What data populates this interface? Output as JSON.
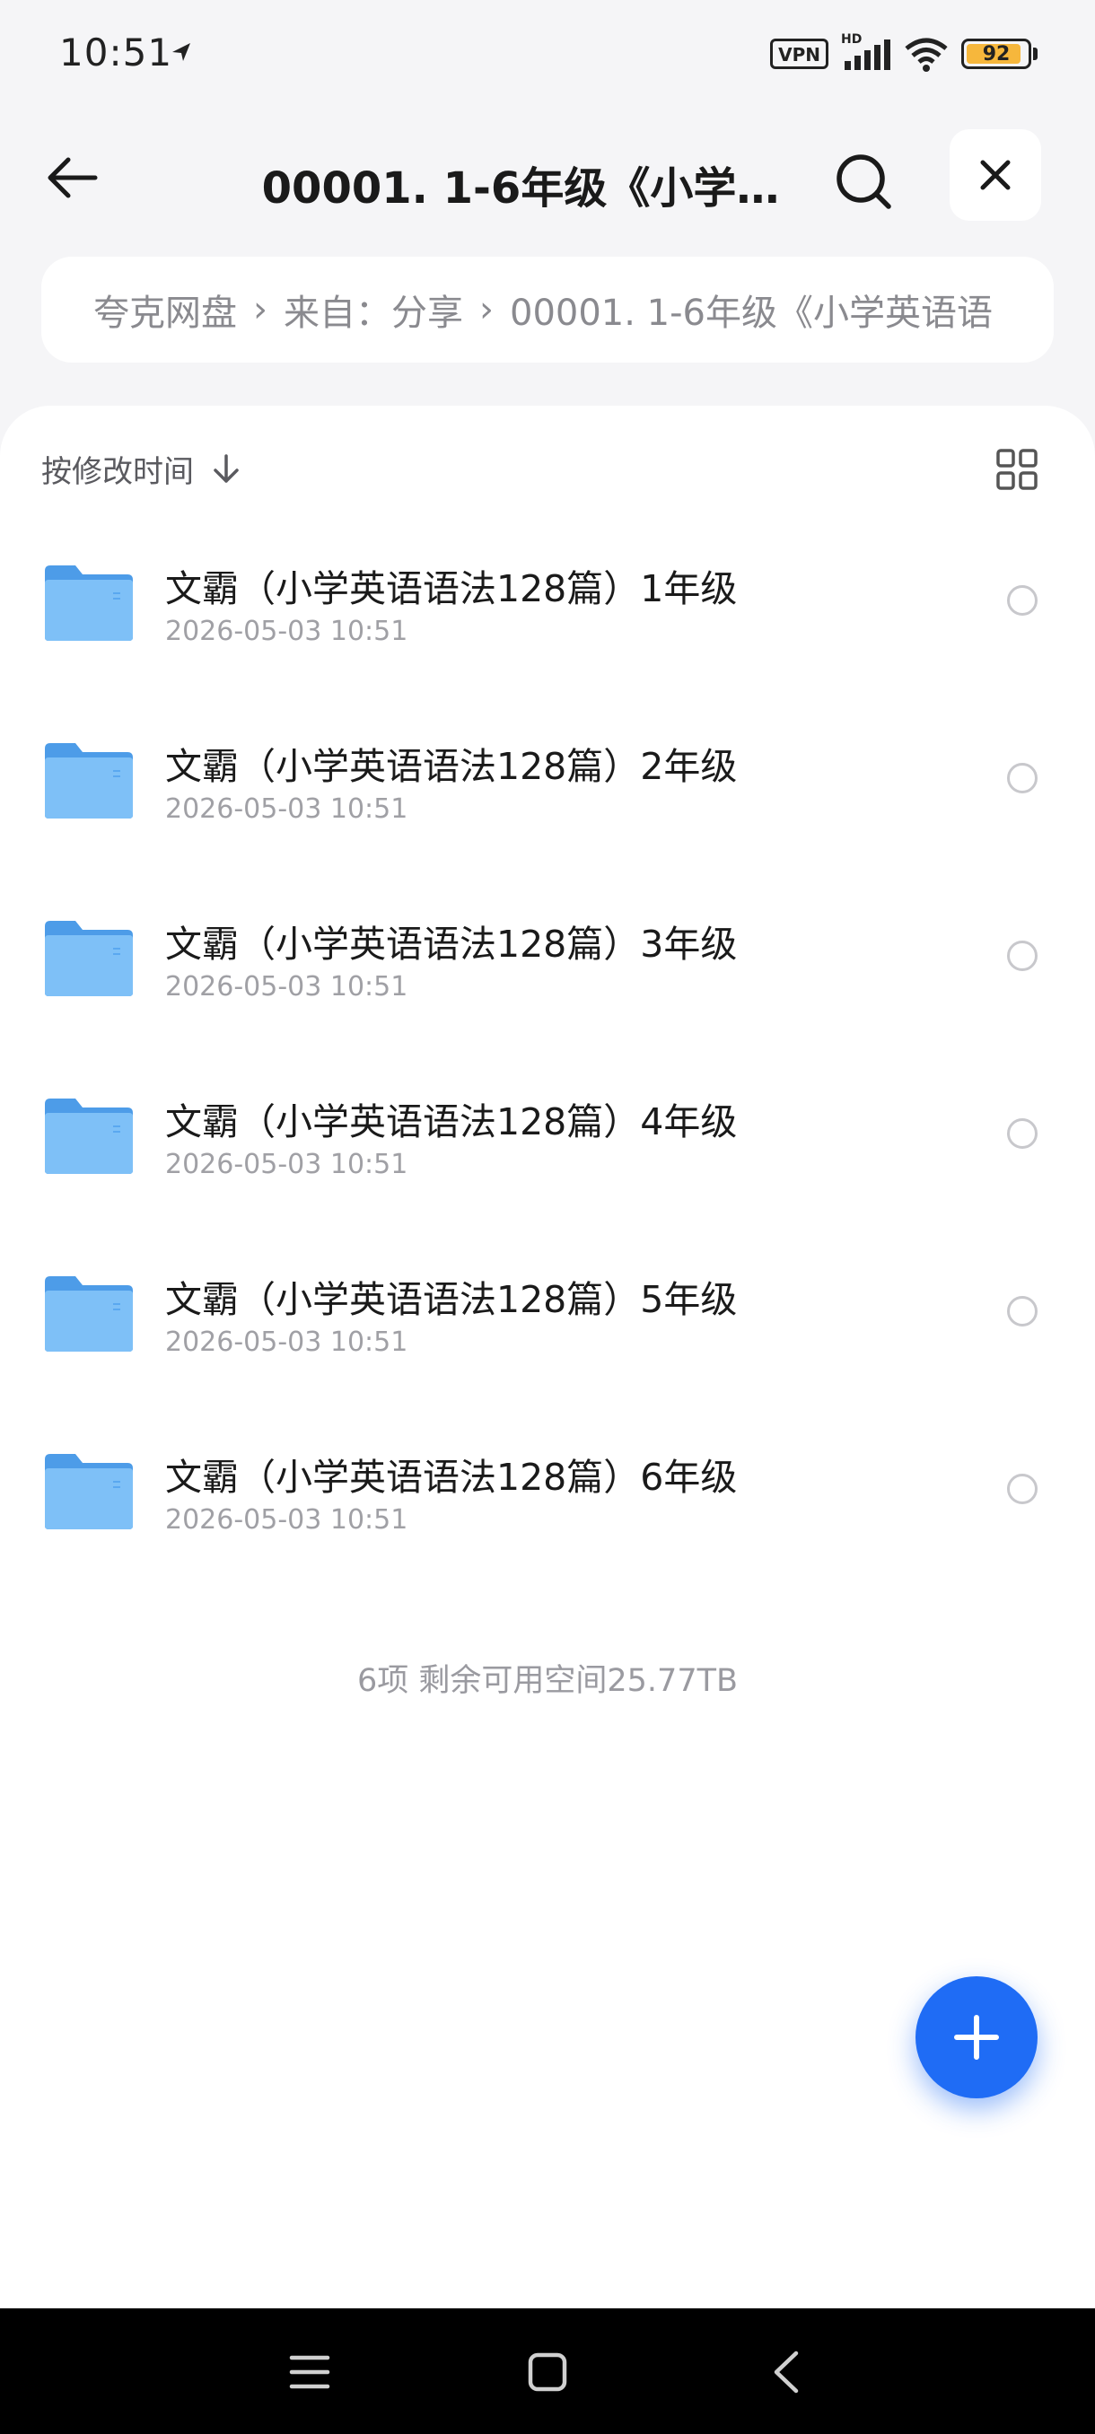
{
  "status_bar": {
    "time": "10:51",
    "vpn": "VPN",
    "network": "HD",
    "battery": "92",
    "battery_level": 0.92
  },
  "header": {
    "title": "00001. 1-6年级《小学…",
    "back_icon": "arrow-left-icon",
    "search_icon": "search-icon",
    "close_icon": "close-icon"
  },
  "breadcrumb": {
    "items": [
      "夸克网盘",
      "来自：分享",
      "00001. 1-6年级《小学英语语"
    ]
  },
  "toolbar": {
    "sort_label": "按修改时间",
    "sort_icon": "arrow-down-icon",
    "view_icon": "grid-view-icon"
  },
  "files": [
    {
      "name": "文霸（小学英语语法128篇）1年级",
      "date": "2026-05-03 10:51"
    },
    {
      "name": "文霸（小学英语语法128篇）2年级",
      "date": "2026-05-03 10:51"
    },
    {
      "name": "文霸（小学英语语法128篇）3年级",
      "date": "2026-05-03 10:51"
    },
    {
      "name": "文霸（小学英语语法128篇）4年级",
      "date": "2026-05-03 10:51"
    },
    {
      "name": "文霸（小学英语语法128篇）5年级",
      "date": "2026-05-03 10:51"
    },
    {
      "name": "文霸（小学英语语法128篇）6年级",
      "date": "2026-05-03 10:51"
    }
  ],
  "summary": "6项 剩余可用空间25.77TB",
  "fab_icon": "plus-icon",
  "colors": {
    "accent": "#1f6cf5",
    "folder": "#5aa8f0",
    "battery": "#f6b73c"
  }
}
